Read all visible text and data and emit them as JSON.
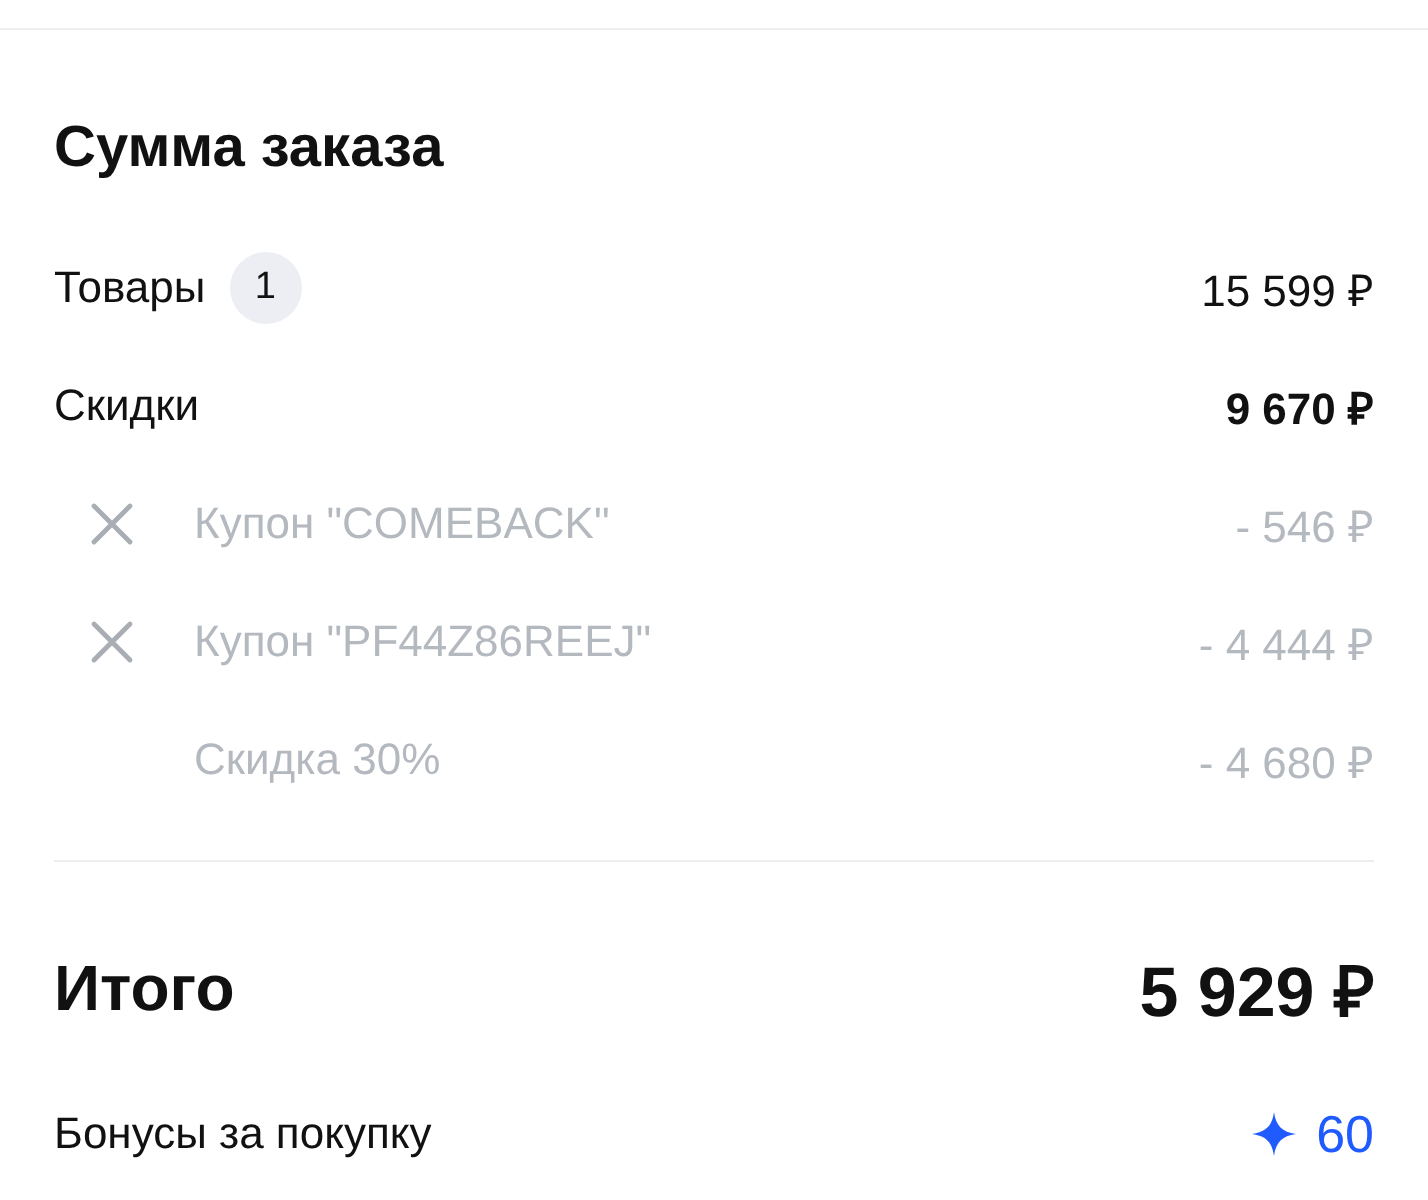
{
  "title": "Сумма заказа",
  "items": {
    "label": "Товары",
    "count": "1",
    "amount": "15 599 ₽"
  },
  "discounts": {
    "label": "Скидки",
    "amount": "9 670 ₽"
  },
  "discount_lines": [
    {
      "label": "Купон \"COMEBACK\"",
      "amount": "- 546 ₽",
      "removable": true
    },
    {
      "label": "Купон \"PF44Z86REEJ\"",
      "amount": "- 4 444 ₽",
      "removable": true
    },
    {
      "label": "Скидка 30%",
      "amount": "- 4 680 ₽",
      "removable": false
    }
  ],
  "total": {
    "label": "Итого",
    "amount": "5 929 ₽"
  },
  "bonus": {
    "label": "Бонусы за покупку",
    "amount": "60"
  }
}
